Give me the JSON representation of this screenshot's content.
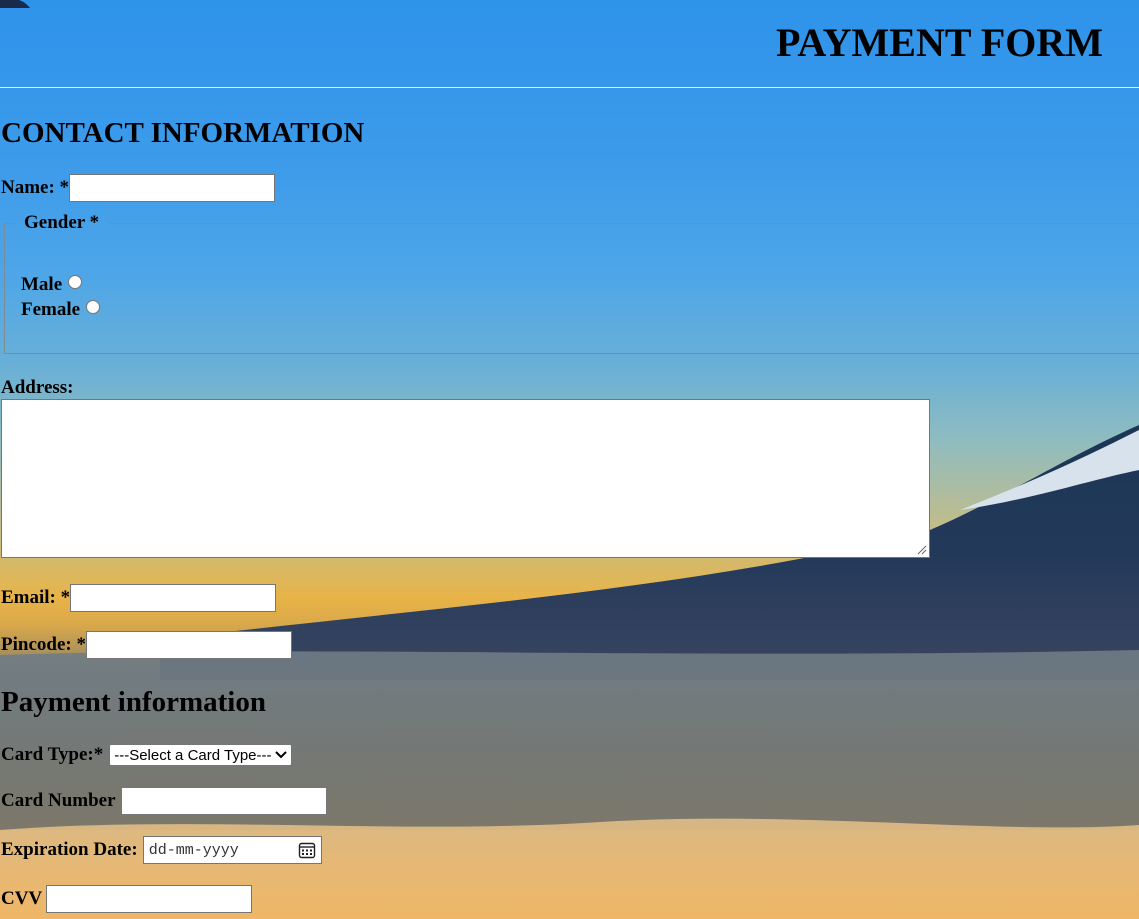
{
  "header": {
    "title": "PAYMENT FORM"
  },
  "contact": {
    "heading": "CONTACT INFORMATION",
    "name_label": "Name: *",
    "name_value": "",
    "gender": {
      "legend": "Gender *",
      "options": [
        {
          "label": "Male",
          "checked": false
        },
        {
          "label": "Female",
          "checked": false
        }
      ]
    },
    "address_label": "Address:",
    "address_value": "",
    "email_label": "Email: *",
    "email_value": "",
    "pincode_label": "Pincode: *",
    "pincode_value": ""
  },
  "payment": {
    "heading": "Payment information",
    "card_type_label": "Card Type:*",
    "card_type_selected": "---Select a Card Type---",
    "card_number_label": "Card Number",
    "card_number_value": "",
    "expiration_label": "Expiration Date:",
    "expiration_placeholder": "dd-mm-yyyy",
    "cvv_label": "CVV",
    "cvv_value": ""
  },
  "icons": {
    "select_arrow": "chevron-down-icon",
    "date_picker": "calendar-icon"
  },
  "colors": {
    "text": "#000000",
    "input_background": "#ffffff",
    "input_border": "#767676",
    "sky_top": "#2e93ea",
    "horizon_gold": "#e8b448"
  }
}
